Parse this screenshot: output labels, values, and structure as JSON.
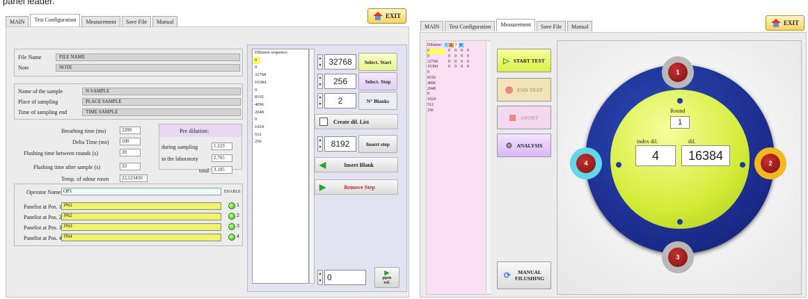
{
  "caption": "panel leader.",
  "left": {
    "tabs": [
      "MAIN",
      "Test Configuration",
      "Measurement",
      "Save File",
      "Manual"
    ],
    "exit_label": "EXIT",
    "file_name_label": "File Name",
    "file_name_value": "FILE NAME",
    "note_label": "Note",
    "note_value": "NOTE",
    "sample_name_label": "Name of the sample",
    "sample_name_value": "N SAMPLE",
    "place_label": "Place of sampling",
    "place_value": "PLACE SAMPLE",
    "time_end_label": "Time of sampling end",
    "time_end_value": "TIME SAMPLE",
    "breathing_label": "Breathing time (ms)",
    "breathing_value": "2200",
    "delta_label": "Delta Time (ms)",
    "delta_value": "100",
    "flush_rounds_label": "Flushing time between rounds (s)",
    "flush_rounds_value": "20",
    "flush_after_label": "Flushing time after sample (s)",
    "flush_after_value": "33",
    "temp_label": "Temp. of odour room",
    "temp_value": "22,123456",
    "predilution_title": "Pre dilution:",
    "during_label": "during sampling",
    "during_value": "1.123",
    "lab_label": "in the laboratory",
    "lab_value": "2.765",
    "total_label": "total",
    "total_value": "3.105",
    "operator_label": "Operator Name",
    "operator_value": "OP1",
    "enable_label": "ENABLE",
    "panelists": [
      {
        "label": "Panelist at Pos. 1",
        "value": "PN1",
        "num": "1"
      },
      {
        "label": "Panelist at Pos. 2",
        "value": "PN2",
        "num": "2"
      },
      {
        "label": "Panelist at Pos. 3",
        "value": "PN3",
        "num": "3"
      },
      {
        "label": "Panelist at Pos. 4",
        "value": "PN4",
        "num": "4"
      }
    ],
    "dilution_header": "Dilution sequence",
    "dilution_first": "0",
    "dilution_list": [
      "0",
      "32768",
      "16384",
      "0",
      "8192",
      "4096",
      "2048",
      "0",
      "1024",
      "512",
      "256"
    ],
    "select_start_value": "32768",
    "select_start_label": "Select. Start",
    "select_stop_value": "256",
    "select_stop_label": "Select. Stop",
    "blanks_value": "2",
    "blanks_label": "N° Blanks",
    "create_list_label": "Create dil. List",
    "insert_step_value": "8192",
    "insert_step_label": "Insert step",
    "insert_blank_label": "Insert Blank",
    "remove_step_label": "Remove Step",
    "ppm_value": "0",
    "ppm_label_1": "ppm",
    "ppm_label_2": "ref."
  },
  "right": {
    "tabs": [
      "MAIN",
      "Test Configuration",
      "Measurement",
      "Save File",
      "Manual"
    ],
    "exit_label": "EXIT",
    "dil_header": "Dilution",
    "col_headers": [
      "1",
      "2",
      "3",
      "4"
    ],
    "rows": [
      {
        "d": "0",
        "v": [
          "0",
          "0",
          "0",
          "0"
        ]
      },
      {
        "d": "0",
        "v": [
          "0",
          "0",
          "0",
          "0"
        ]
      },
      {
        "d": "32768",
        "v": [
          "0",
          "0",
          "0",
          "0"
        ]
      },
      {
        "d": "16384",
        "v": [
          "0",
          "0",
          "0",
          "0"
        ]
      },
      {
        "d": "0",
        "v": [
          "",
          "",
          "",
          ""
        ]
      },
      {
        "d": "8192",
        "v": [
          "",
          "",
          "",
          ""
        ]
      },
      {
        "d": "4096",
        "v": [
          "",
          "",
          "",
          ""
        ]
      },
      {
        "d": "2048",
        "v": [
          "",
          "",
          "",
          ""
        ]
      },
      {
        "d": "0",
        "v": [
          "",
          "",
          "",
          ""
        ]
      },
      {
        "d": "1024",
        "v": [
          "",
          "",
          "",
          ""
        ]
      },
      {
        "d": "512",
        "v": [
          "",
          "",
          "",
          ""
        ]
      },
      {
        "d": "256",
        "v": [
          "",
          "",
          "",
          ""
        ]
      }
    ],
    "start_label": "START TEST",
    "end_label": "END TEST",
    "abort_label": "ABORT",
    "analysis_label": "ANALYSIS",
    "manual_label_1": "MANUAL",
    "manual_label_2": "FILUSHING",
    "round_label": "Round",
    "round_value": "1",
    "index_label": "index dil.",
    "index_value": "4",
    "dil_label": "dil.",
    "dil_value": "16384",
    "positions": [
      "1",
      "2",
      "3",
      "4"
    ]
  }
}
